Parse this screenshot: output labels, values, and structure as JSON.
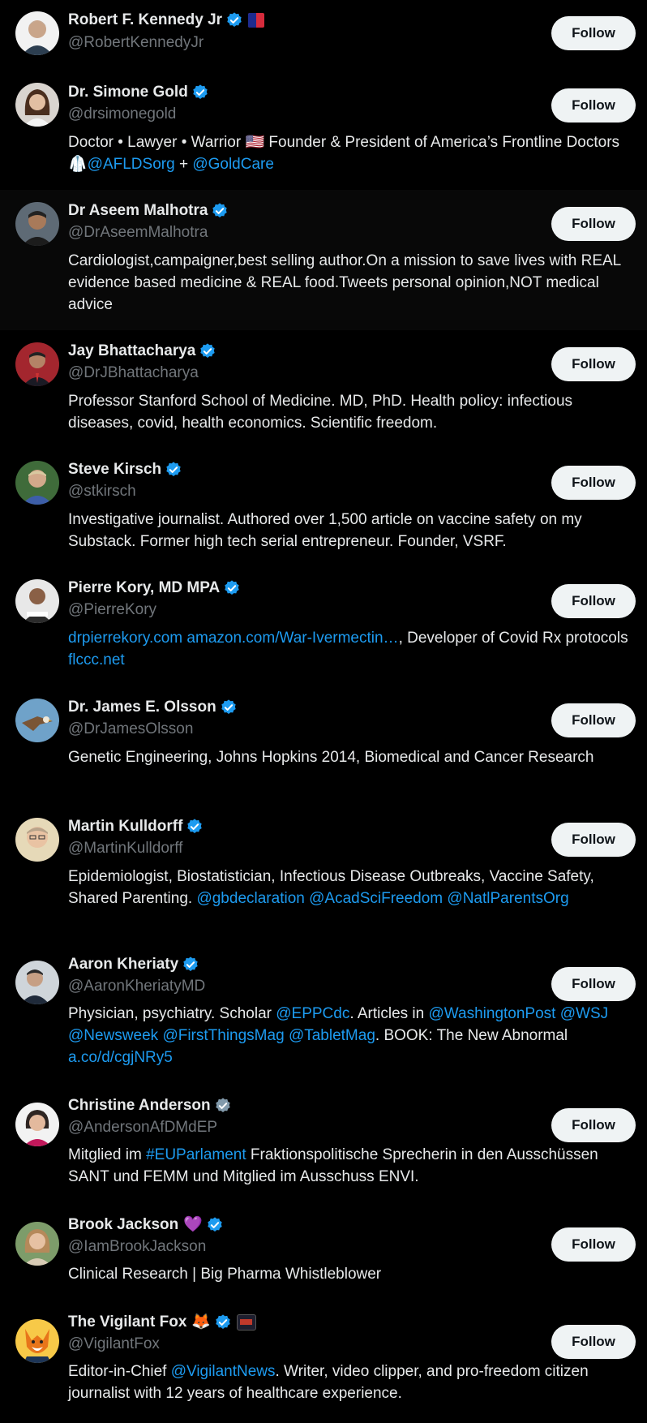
{
  "colors": {
    "background": "#000000",
    "hover_row": "#080808",
    "text": "#e7e9ea",
    "muted": "#71767b",
    "link": "#1d9bf0",
    "verified_blue": "#1d9bf0",
    "verified_gray": "#829aab",
    "button_bg": "#eff3f4"
  },
  "users": [
    {
      "name": "Robert F. Kennedy Jr",
      "handle": "@RobertKennedyJr",
      "verified": "blue",
      "badge": "campaign-flag-icon",
      "follow_label": "Follow",
      "bio": []
    },
    {
      "name": "Dr. Simone Gold",
      "handle": "@drsimonegold",
      "verified": "blue",
      "follow_label": "Follow",
      "bio": [
        {
          "t": "Doctor • Lawyer • Warrior 🇺🇸 Founder & President of America’s Frontline Doctors🥼"
        },
        {
          "t": "@AFLDSorg",
          "link": true
        },
        {
          "t": " + "
        },
        {
          "t": "@GoldCare",
          "link": true
        }
      ]
    },
    {
      "name": "Dr Aseem Malhotra",
      "handle": "@DrAseemMalhotra",
      "verified": "blue",
      "follow_label": "Follow",
      "bio": [
        {
          "t": "Cardiologist,campaigner,best selling author.On a mission to save lives with REAL evidence based medicine & REAL food.Tweets personal opinion,NOT medical advice"
        }
      ]
    },
    {
      "name": "Jay Bhattacharya",
      "handle": "@DrJBhattacharya",
      "verified": "blue",
      "follow_label": "Follow",
      "bio": [
        {
          "t": "Professor Stanford School of Medicine. MD, PhD. Health policy: infectious diseases, covid, health economics. Scientific freedom."
        }
      ]
    },
    {
      "name": "Steve Kirsch",
      "handle": "@stkirsch",
      "verified": "blue",
      "follow_label": "Follow",
      "bio": [
        {
          "t": "Investigative journalist. Authored over 1,500 article on vaccine safety on my Substack. Former high tech serial entrepreneur. Founder, VSRF."
        }
      ]
    },
    {
      "name": "Pierre Kory, MD MPA",
      "handle": "@PierreKory",
      "verified": "blue",
      "follow_label": "Follow",
      "bio": [
        {
          "t": "drpierrekory.com",
          "link": true
        },
        {
          "t": " "
        },
        {
          "t": "amazon.com/War-Ivermectin…",
          "link": true
        },
        {
          "t": ", Developer of Covid Rx protocols "
        },
        {
          "t": "flccc.net",
          "link": true
        }
      ]
    },
    {
      "name": "Dr. James E. Olsson",
      "handle": "@DrJamesOlsson",
      "verified": "blue",
      "follow_label": "Follow",
      "bio": [
        {
          "t": "Genetic Engineering, Johns Hopkins 2014, Biomedical and Cancer Research"
        }
      ]
    },
    {
      "name": "Martin Kulldorff",
      "handle": "@MartinKulldorff",
      "verified": "blue",
      "follow_label": "Follow",
      "bio": [
        {
          "t": "Epidemiologist, Biostatistician, Infectious Disease Outbreaks, Vaccine Safety, Shared Parenting. "
        },
        {
          "t": "@gbdeclaration",
          "link": true
        },
        {
          "t": " "
        },
        {
          "t": "@AcadSciFreedom",
          "link": true
        },
        {
          "t": " "
        },
        {
          "t": "@NatlParentsOrg",
          "link": true
        }
      ]
    },
    {
      "name": "Aaron Kheriaty",
      "handle": "@AaronKheriatyMD",
      "verified": "blue",
      "follow_label": "Follow",
      "bio": [
        {
          "t": "Physician, psychiatry. Scholar "
        },
        {
          "t": "@EPPCdc",
          "link": true
        },
        {
          "t": ". Articles in "
        },
        {
          "t": "@WashingtonPost",
          "link": true
        },
        {
          "t": " "
        },
        {
          "t": "@WSJ",
          "link": true
        },
        {
          "t": " "
        },
        {
          "t": "@Newsweek",
          "link": true
        },
        {
          "t": " "
        },
        {
          "t": "@FirstThingsMag",
          "link": true
        },
        {
          "t": " "
        },
        {
          "t": "@TabletMag",
          "link": true
        },
        {
          "t": ". BOOK: The New Abnormal "
        },
        {
          "t": "a.co/d/cgjNRy5",
          "link": true
        }
      ]
    },
    {
      "name": "Christine Anderson",
      "handle": "@AndersonAfDMdEP",
      "verified": "gray",
      "follow_label": "Follow",
      "bio": [
        {
          "t": "Mitglied im "
        },
        {
          "t": "#EUParlament",
          "link": true
        },
        {
          "t": " Fraktionspolitische Sprecherin in den Ausschüssen SANT und FEMM und Mitglied im Ausschuss ENVI."
        }
      ]
    },
    {
      "name": "Brook Jackson",
      "name_emoji": "💜",
      "handle": "@IamBrookJackson",
      "verified": "blue",
      "follow_label": "Follow",
      "bio": [
        {
          "t": "Clinical Research | Big Pharma Whistleblower"
        }
      ]
    },
    {
      "name": "The Vigilant Fox",
      "name_emoji": "🦊",
      "handle": "@VigilantFox",
      "verified": "blue",
      "badge": "vigilant-news-badge-icon",
      "follow_label": "Follow",
      "bio": [
        {
          "t": "Editor-in-Chief "
        },
        {
          "t": "@VigilantNews",
          "link": true
        },
        {
          "t": ". Writer, video clipper, and pro-freedom citizen journalist with 12 years of healthcare experience."
        }
      ]
    }
  ]
}
